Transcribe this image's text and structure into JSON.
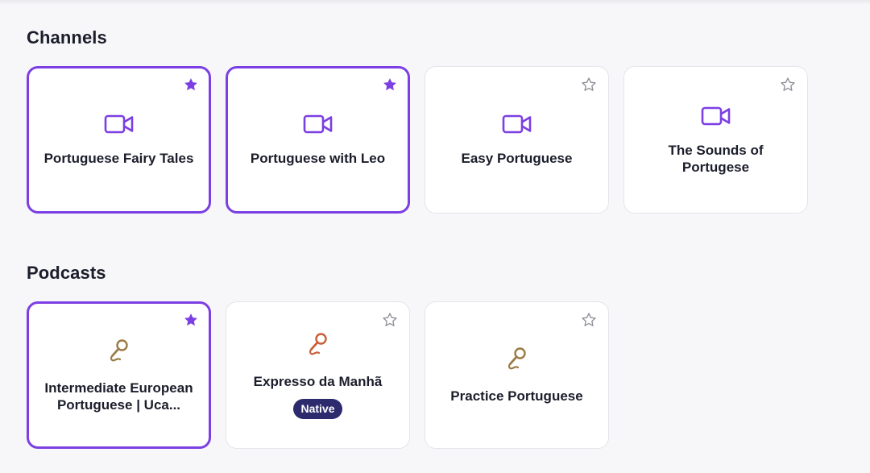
{
  "colors": {
    "accent": "#7b3fe4",
    "star_outline": "#8f8f99",
    "mic_olive": "#9a7b45",
    "mic_orange": "#c95f38",
    "badge_bg": "#2e2a6e"
  },
  "channels": {
    "heading": "Channels",
    "cards": [
      {
        "title": "Portuguese Fairy Tales",
        "icon": "video-camera-icon",
        "favorited": true
      },
      {
        "title": "Portuguese with Leo",
        "icon": "video-camera-icon",
        "favorited": true
      },
      {
        "title": "Easy Portuguese",
        "icon": "video-camera-icon",
        "favorited": false
      },
      {
        "title": "The Sounds of Portugese",
        "icon": "video-camera-icon",
        "favorited": false
      }
    ]
  },
  "podcasts": {
    "heading": "Podcasts",
    "cards": [
      {
        "title": "Intermediate European Portuguese | Uca...",
        "icon": "microphone-icon",
        "favorited": true
      },
      {
        "title": "Expresso da Manhã",
        "icon": "microphone-icon",
        "favorited": false,
        "badge": "Native"
      },
      {
        "title": "Practice Portuguese",
        "icon": "microphone-icon",
        "favorited": false
      }
    ]
  }
}
